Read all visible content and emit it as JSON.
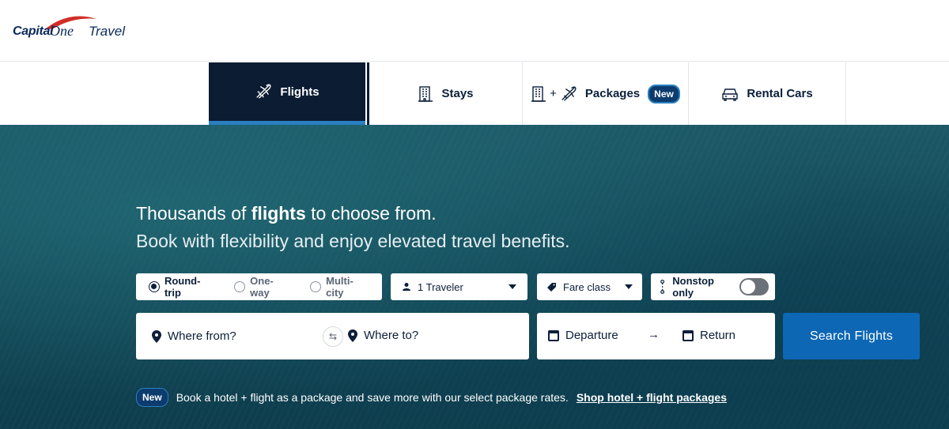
{
  "brand": {
    "capital": "Capital",
    "one": "One",
    "travel": "Travel",
    "logo_icon": "capital-one-swoosh"
  },
  "tabs": [
    {
      "label": "Flights",
      "icon": "airplane-icon",
      "active": true
    },
    {
      "label": "Stays",
      "icon": "building-icon"
    },
    {
      "label": "Packages",
      "icon": "building-plus-airplane-icon",
      "plus": "+",
      "badge": "New"
    },
    {
      "label": "Rental Cars",
      "icon": "car-icon"
    }
  ],
  "hero": {
    "headline_pre": "Thousands of ",
    "headline_bold": "flights",
    "headline_post": " to choose from.",
    "subline": "Book with flexibility and enjoy elevated travel benefits."
  },
  "trip_type": {
    "options": [
      "Round-trip",
      "One-way",
      "Multi-city"
    ],
    "selected": "Round-trip"
  },
  "travelers": {
    "value": "1 Traveler"
  },
  "fare_class": {
    "value": "Fare class"
  },
  "nonstop": {
    "label": "Nonstop only",
    "enabled": false
  },
  "route": {
    "from_placeholder": "Where from?",
    "to_placeholder": "Where to?",
    "swap_icon": "swap-arrows-icon"
  },
  "dates": {
    "departure": "Departure",
    "return": "Return",
    "arrow": "→"
  },
  "search_button": "Search Flights",
  "promo": {
    "badge": "New",
    "text": "Book a hotel + flight as a package and save more with our select package rates.",
    "link": "Shop hotel + flight packages"
  },
  "colors": {
    "navy": "#0b1c33",
    "accent_blue": "#0d67b5",
    "tab_underline": "#2a7fc1",
    "brand_red": "#d03027"
  }
}
